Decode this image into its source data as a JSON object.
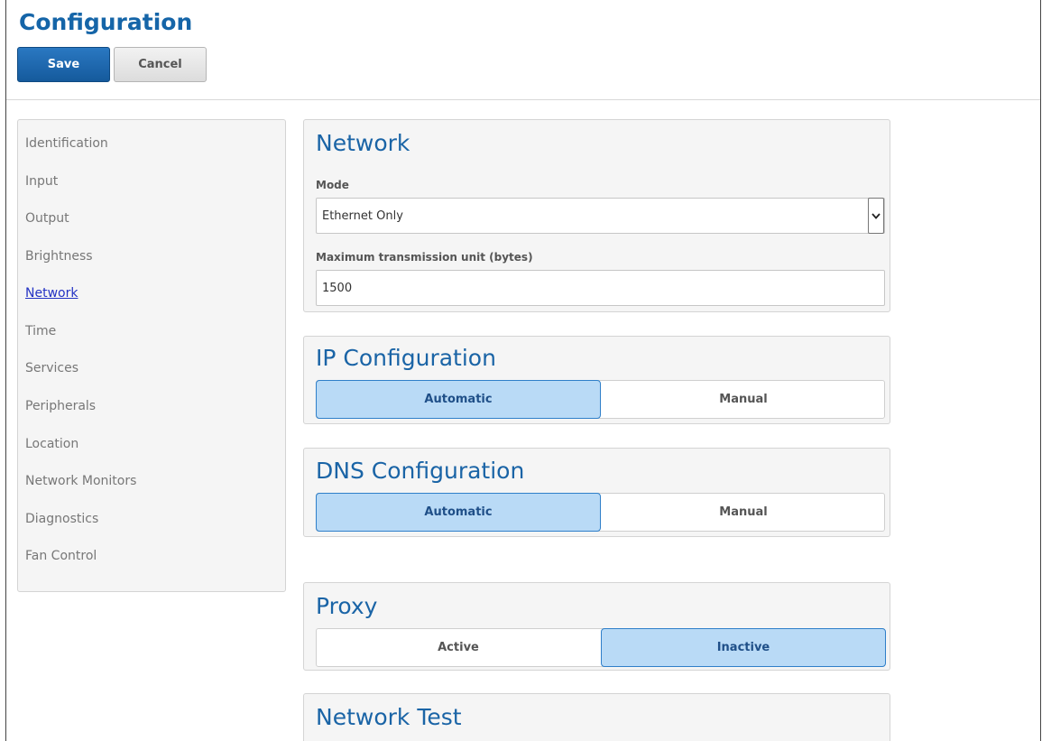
{
  "header": {
    "title": "Configuration",
    "save_label": "Save",
    "cancel_label": "Cancel"
  },
  "sidebar": {
    "items": [
      {
        "label": "Identification"
      },
      {
        "label": "Input"
      },
      {
        "label": "Output"
      },
      {
        "label": "Brightness"
      },
      {
        "label": "Network",
        "active": true
      },
      {
        "label": "Time"
      },
      {
        "label": "Services"
      },
      {
        "label": "Peripherals"
      },
      {
        "label": "Location"
      },
      {
        "label": "Network Monitors"
      },
      {
        "label": "Diagnostics"
      },
      {
        "label": "Fan Control"
      }
    ]
  },
  "network": {
    "title": "Network",
    "mode_label": "Mode",
    "mode_value": "Ethernet Only",
    "mtu_label": "Maximum transmission unit (bytes)",
    "mtu_value": "1500"
  },
  "ip_config": {
    "title": "IP Configuration",
    "options": [
      "Automatic",
      "Manual"
    ],
    "selected": "Automatic"
  },
  "dns_config": {
    "title": "DNS Configuration",
    "options": [
      "Automatic",
      "Manual"
    ],
    "selected": "Automatic"
  },
  "proxy": {
    "title": "Proxy",
    "options": [
      "Active",
      "Inactive"
    ],
    "selected": "Inactive"
  },
  "network_test": {
    "title": "Network Test"
  },
  "colors": {
    "brand_blue": "#1565a8",
    "selected_fill": "#b9daf6",
    "active_link": "#2433c4"
  }
}
